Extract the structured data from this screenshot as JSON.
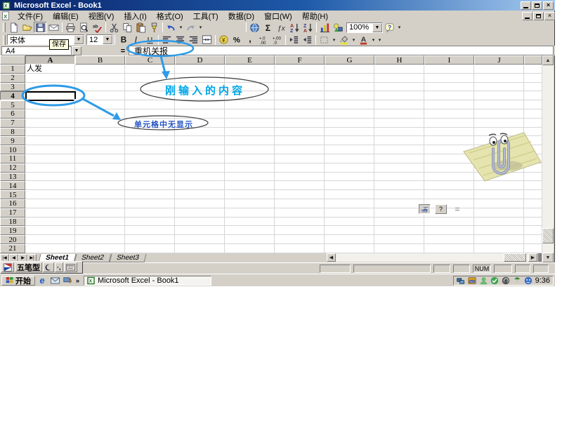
{
  "window": {
    "title": "Microsoft Excel - Book1"
  },
  "menus": [
    "文件(F)",
    "编辑(E)",
    "视图(V)",
    "插入(I)",
    "格式(O)",
    "工具(T)",
    "数据(D)",
    "窗口(W)",
    "帮助(H)"
  ],
  "standard_toolbar": {
    "zoom_value": "100%",
    "buttons": [
      "new-icon",
      "open-icon",
      "save-icon",
      "mail-icon",
      "|",
      "print-icon",
      "preview-icon",
      "spell-icon",
      "|",
      "cut-icon",
      "copy-icon",
      "paste-icon",
      "painter-icon",
      "|",
      "undo-icon",
      "▾",
      "redo-icon",
      "▾",
      "SPACER",
      "|",
      "hyperlink-icon",
      "sum-icon",
      "fx-icon",
      "sort-az-icon",
      "sort-za-icon",
      "|",
      "chart-icon",
      "drawing-icon",
      "ZOOM",
      "help-icon",
      "▾"
    ]
  },
  "formatting_toolbar": {
    "font_name": "宋体",
    "font_size": "12",
    "buttons": [
      "FONT",
      "SIZE",
      "|",
      "bold-icon",
      "italic-icon",
      "underline-icon",
      "|",
      "align-left-icon",
      "align-center-icon",
      "align-right-icon",
      "merge-center-icon",
      "|",
      "currency-icon",
      "percent-icon",
      "comma-icon",
      "inc-decimal-icon",
      "dec-decimal-icon",
      "|",
      "dec-indent-icon",
      "inc-indent-icon",
      "|",
      "borders-icon",
      "▾",
      "fill-color-icon",
      "▾",
      "font-color-icon",
      "▾",
      "▾"
    ]
  },
  "tooltip": {
    "text": "保存"
  },
  "formula_bar": {
    "cell_ref": "A4",
    "equals": "=",
    "formula": "重机关报"
  },
  "grid": {
    "columns": [
      "A",
      "B",
      "C",
      "D",
      "E",
      "F",
      "G",
      "H",
      "I",
      "J"
    ],
    "rows": [
      "1",
      "2",
      "3",
      "4",
      "5",
      "6",
      "7",
      "8",
      "9",
      "10",
      "11",
      "12",
      "13",
      "14",
      "15",
      "16",
      "17",
      "18",
      "19",
      "20",
      "21"
    ],
    "cells": {
      "A1": "人发"
    },
    "selected_cell": "A4"
  },
  "annotations": {
    "typed_content": "刚输入的内容",
    "cell_no_display": "单元格中无显示"
  },
  "float_toolbar": {
    "wubi": "五",
    "help": "?"
  },
  "sheet_tabs": {
    "tabs": [
      "Sheet1",
      "Sheet2",
      "Sheet3"
    ],
    "active": "Sheet1"
  },
  "status_bar": {
    "num": "NUM"
  },
  "ime_bar": {
    "name": "五笔型"
  },
  "taskbar": {
    "start_label": "开始",
    "chevron": "»",
    "task_label": "Microsoft Excel - Book1",
    "time": "9:36"
  },
  "colors": {
    "annotation_blue": "#2E9BE8",
    "typed_text": "#00A7E8",
    "nodisplay_text": "#2353C4",
    "title_gradient_start": "#0A246A",
    "title_gradient_end": "#A6CAF0"
  }
}
